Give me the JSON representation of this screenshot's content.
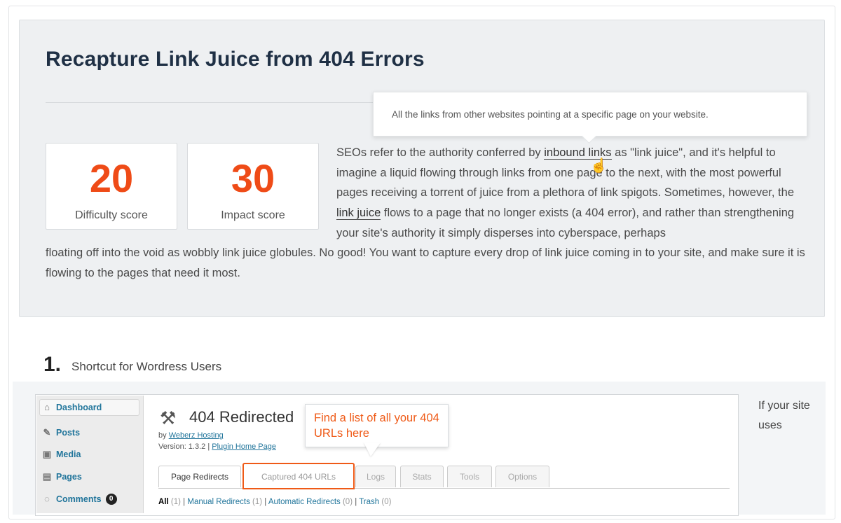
{
  "section": {
    "title": "Recapture Link Juice from 404 Errors",
    "tooltip": "All the links from other websites pointing at a specific page on your website.",
    "scores": [
      {
        "value": "20",
        "label": "Difficulty score"
      },
      {
        "value": "30",
        "label": "Impact score"
      }
    ],
    "paragraph": {
      "p1": "SEOs refer to the authority conferred by ",
      "kw1": "inbound links",
      "p2": " as \"link juice\", and it's helpful to imagine a liquid flowing through links from one page to the next, with the most powerful pages receiving a torrent of juice from a plethora of link spigots. Sometimes, however, the ",
      "kw2": "link juice",
      "p3": " flows to a page that no longer exists (a 404 error), and rather than strengthening your site's authority it simply disperses into cyberspace, perhaps",
      "p4": "floating off into the void as wobbly link juice globules. No good! You want to capture every drop of link juice coming in to your site, and make sure it is flowing to the pages that need it most."
    }
  },
  "step": {
    "number": "1.",
    "title": "Shortcut for Wordress Users"
  },
  "wp": {
    "menu": [
      {
        "label": "Dashboard",
        "icon": "dashboard-icon"
      },
      {
        "label": "Posts",
        "icon": "pin-icon"
      },
      {
        "label": "Media",
        "icon": "media-icon"
      },
      {
        "label": "Pages",
        "icon": "pages-icon"
      },
      {
        "label": "Comments",
        "icon": "comment-icon",
        "badge": "0"
      }
    ],
    "plugin_title": "404 Redirected",
    "by_prefix": "by ",
    "author": "Weberz Hosting",
    "version_prefix": "Version: 1.3.2 | ",
    "plugin_home": "Plugin Home Page",
    "tabs": [
      "Page Redirects",
      "Captured 404 URLs",
      "Logs",
      "Stats",
      "Tools",
      "Options"
    ],
    "filters": [
      {
        "label": "All",
        "count": "(1)"
      },
      {
        "label": "Manual Redirects",
        "count": "(1)"
      },
      {
        "label": "Automatic Redirects",
        "count": "(0)"
      },
      {
        "label": "Trash",
        "count": "(0)"
      }
    ],
    "callout": "Find a list of all your 404 URLs here"
  },
  "side_note": "If your site uses",
  "colors": {
    "accent": "#ef4b17",
    "panel_bg": "#eef0f2",
    "wp_link": "#21759b"
  }
}
